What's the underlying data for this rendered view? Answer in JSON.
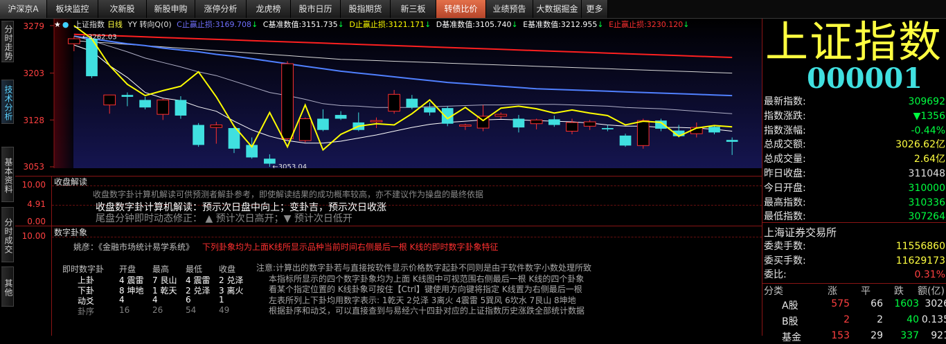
{
  "menu": {
    "items": [
      {
        "label": "沪深京A"
      },
      {
        "label": "板块监控"
      },
      {
        "label": "次新股"
      },
      {
        "label": "新股申购"
      },
      {
        "label": "涨停分析"
      },
      {
        "label": "龙虎榜"
      },
      {
        "label": "股市日历"
      },
      {
        "label": "股指期货"
      },
      {
        "label": "新三板"
      },
      {
        "label": "转债比价"
      },
      {
        "label": "业绩预告"
      },
      {
        "label": "大数据掘金"
      },
      {
        "label": "更多"
      }
    ],
    "highlight_color": "#d2593a"
  },
  "side_tabs": [
    {
      "label": "分时走势"
    },
    {
      "label": "技术分析"
    },
    {
      "label": "基本资料"
    },
    {
      "label": "分时成交"
    },
    {
      "label": "其他"
    }
  ],
  "chart": {
    "header": {
      "title": "上证指数",
      "period": "日线",
      "indicator": "YY 转向Q(0)",
      "c_label": "C止赢止损:",
      "c_value": "3169.708",
      "c_arrow": "↓",
      "cb_label": "C基准数值:",
      "cb_value": "3151.735",
      "cb_arrow": "↓",
      "d_label": "D止赢止损:",
      "d_value": "3121.171",
      "d_arrow": "↓",
      "db_label": "D基准数值:",
      "db_value": "3105.740",
      "db_arrow": "↓",
      "eb_label": "E基准数值:",
      "eb_value": "3212.955",
      "eb_arrow": "↓",
      "e_label": "E止赢止损:",
      "e_value": "3230.120",
      "e_arrow": "↓"
    },
    "y_ticks": [
      "3279",
      "3203",
      "3128",
      "3053"
    ],
    "high_label": "3262.03",
    "low_label": "3053.04",
    "colors": {
      "up": "#ff3030",
      "down": "#40e0e0",
      "yellow": "#ffff00",
      "white": "#ffffff",
      "red_ma": "#ff2020",
      "blue_ma": "#5080ff",
      "bg": "#0a0a40"
    }
  },
  "chart_data": {
    "type": "candlestick",
    "ylim": [
      3053,
      3279
    ],
    "candles": [
      {
        "o": 3250,
        "h": 3262,
        "l": 3238,
        "c": 3258
      },
      {
        "o": 3258,
        "h": 3260,
        "l": 3195,
        "c": 3198
      },
      {
        "o": 3152,
        "h": 3168,
        "l": 3138,
        "c": 3168
      },
      {
        "o": 3168,
        "h": 3172,
        "l": 3150,
        "c": 3165
      },
      {
        "o": 3160,
        "h": 3165,
        "l": 3145,
        "c": 3148
      },
      {
        "o": 3137,
        "h": 3162,
        "l": 3128,
        "c": 3160
      },
      {
        "o": 3160,
        "h": 3166,
        "l": 3130,
        "c": 3135
      },
      {
        "o": 3120,
        "h": 3123,
        "l": 3085,
        "c": 3088
      },
      {
        "o": 3116,
        "h": 3125,
        "l": 3090,
        "c": 3120
      },
      {
        "o": 3115,
        "h": 3120,
        "l": 3075,
        "c": 3082
      },
      {
        "o": 3088,
        "h": 3100,
        "l": 3066,
        "c": 3068
      },
      {
        "o": 3066,
        "h": 3073,
        "l": 3053,
        "c": 3058
      },
      {
        "o": 3098,
        "h": 3222,
        "l": 3095,
        "c": 3218
      },
      {
        "o": 3095,
        "h": 3132,
        "l": 3092,
        "c": 3130
      },
      {
        "o": 3130,
        "h": 3145,
        "l": 3110,
        "c": 3112
      },
      {
        "o": 3136,
        "h": 3142,
        "l": 3128,
        "c": 3130
      },
      {
        "o": 3124,
        "h": 3140,
        "l": 3110,
        "c": 3112
      },
      {
        "o": 3125,
        "h": 3132,
        "l": 3115,
        "c": 3127
      },
      {
        "o": 3142,
        "h": 3176,
        "l": 3138,
        "c": 3169
      },
      {
        "o": 3162,
        "h": 3168,
        "l": 3145,
        "c": 3148
      },
      {
        "o": 3148,
        "h": 3156,
        "l": 3135,
        "c": 3140
      },
      {
        "o": 3147,
        "h": 3150,
        "l": 3118,
        "c": 3122
      },
      {
        "o": 3118,
        "h": 3122,
        "l": 3112,
        "c": 3120
      },
      {
        "o": 3115,
        "h": 3152,
        "l": 3110,
        "c": 3134
      },
      {
        "o": 3134,
        "h": 3140,
        "l": 3130,
        "c": 3137
      },
      {
        "o": 3130,
        "h": 3136,
        "l": 3108,
        "c": 3116
      },
      {
        "o": 3122,
        "h": 3130,
        "l": 3113,
        "c": 3128
      },
      {
        "o": 3129,
        "h": 3135,
        "l": 3117,
        "c": 3120
      },
      {
        "o": 3110,
        "h": 3130,
        "l": 3105,
        "c": 3124
      },
      {
        "o": 3118,
        "h": 3128,
        "l": 3112,
        "c": 3125
      },
      {
        "o": 3115,
        "h": 3120,
        "l": 3110,
        "c": 3113
      },
      {
        "o": 3103,
        "h": 3106,
        "l": 3085,
        "c": 3087
      },
      {
        "o": 3087,
        "h": 3130,
        "l": 3082,
        "c": 3127
      },
      {
        "o": 3127,
        "h": 3130,
        "l": 3110,
        "c": 3114
      },
      {
        "o": 3111,
        "h": 3120,
        "l": 3100,
        "c": 3102
      },
      {
        "o": 3106,
        "h": 3124,
        "l": 3100,
        "c": 3116
      },
      {
        "o": 3117,
        "h": 3120,
        "l": 3105,
        "c": 3108
      },
      {
        "o": 3096,
        "h": 3100,
        "l": 3072,
        "c": 3093
      }
    ],
    "lines": {
      "yellow": [
        3279,
        3258,
        3215,
        3185,
        3167,
        3175,
        3182,
        3205,
        3165,
        3118,
        3085,
        3140,
        3085,
        3152,
        3080,
        3105,
        3118,
        3122,
        3120,
        3138,
        3160,
        3130,
        3148,
        3127,
        3147,
        3150,
        3146,
        3139,
        3144,
        3139,
        3135,
        3120,
        3126,
        3124,
        3102,
        3115,
        3119,
        3117
      ],
      "white": [
        3248,
        3238,
        3215,
        3196,
        3172,
        3163,
        3159,
        3149,
        3142,
        3126,
        3112,
        3102,
        3095,
        3091,
        3091,
        3094,
        3099,
        3104,
        3110,
        3116,
        3121,
        3124,
        3126,
        3128,
        3129,
        3128,
        3127,
        3126,
        3125,
        3123,
        3120,
        3118,
        3118,
        3116,
        3116,
        3115,
        3113,
        3110
      ],
      "grey": [
        3262,
        3255,
        3246,
        3237,
        3227,
        3220,
        3213,
        3205,
        3199,
        3190,
        3181,
        3172,
        3167,
        3161,
        3154,
        3151,
        3150,
        3148,
        3148,
        3148,
        3149,
        3150,
        3151,
        3152,
        3152,
        3153,
        3153,
        3153,
        3152,
        3151,
        3150,
        3148,
        3147,
        3146,
        3144,
        3142,
        3140,
        3138
      ],
      "blue": [
        3262,
        3258,
        3254,
        3250,
        3247,
        3243,
        3240,
        3237,
        3233,
        3230,
        3226,
        3222,
        3218,
        3214,
        3210,
        3206,
        3203,
        3200,
        3197,
        3194,
        3191,
        3188,
        3186,
        3184,
        3182,
        3180,
        3178,
        3177,
        3176,
        3175,
        3174,
        3173,
        3172,
        3171,
        3170,
        3169,
        3168,
        3167
      ],
      "offwhite": [
        3255,
        3253,
        3251,
        3249,
        3247,
        3245,
        3243,
        3241,
        3239,
        3237,
        3235,
        3233,
        3231,
        3229,
        3227,
        3225,
        3224,
        3223,
        3222,
        3221,
        3220,
        3219,
        3218,
        3217,
        3216,
        3215,
        3214,
        3213,
        3212,
        3211,
        3210,
        3209,
        3208,
        3207,
        3206,
        3205,
        3204,
        3203
      ],
      "red": [
        3265,
        3264,
        3263,
        3262,
        3261,
        3260,
        3259,
        3258,
        3257,
        3256,
        3255,
        3254,
        3253,
        3252,
        3251,
        3250,
        3249,
        3248,
        3247,
        3246,
        3245,
        3244,
        3243,
        3242,
        3241,
        3240,
        3239,
        3238,
        3237,
        3236,
        3235,
        3234,
        3233,
        3232,
        3231,
        3230,
        3229,
        3228
      ]
    }
  },
  "panel1": {
    "title": "收盘解读",
    "scale": [
      "10.00",
      "4.91",
      "0.00"
    ],
    "line1": "收盘数字卦计算机解读可供预测者解卦参考，即使解读结果的成功概率较高，亦不建议作为操盘的最终依据",
    "line2": "收盘数字卦计算机解读：预示次日盘中向上；变卦吉，预示次日收涨",
    "line3": "尾盘分钟即时动态修正：  ▲ 预计次日高开；▼ 预计次日低开"
  },
  "panel2": {
    "title": "数字卦象",
    "scale": [
      "10.00"
    ],
    "subtitle_black": "姚彦：《金融市场统计易学系统》",
    "subtitle_red": "下列卦象均为上面K线所显示品种当前时间右侧最后一根 K线的即时数字卦象特征",
    "table_headers": [
      "即时数字卦",
      "开盘",
      "最高",
      "最低",
      "收盘"
    ],
    "rows": [
      {
        "name": "上卦",
        "c1": "4 震雷",
        "c2": "7 艮山",
        "c3": "4 震雷",
        "c4": "2 兑泽"
      },
      {
        "name": "下卦",
        "c1": "8 坤地",
        "c2": "1 乾天",
        "c3": "2 兑泽",
        "c4": "3 离火"
      },
      {
        "name": "动爻",
        "c1": "4",
        "c2": "4",
        "c3": "6",
        "c4": "1"
      },
      {
        "name": "卦序",
        "c1": "16",
        "c2": "26",
        "c3": "54",
        "c4": "49"
      }
    ],
    "notes": [
      "注意:计算出的数字卦若与直接按软件显示价格数字起卦不同则是由于软件数字小数处理所致",
      "本指标所显示的四个数字卦象均为上面 K线图中可视范围右侧最后一根 K线的四个卦象",
      "看某个指定位置的 K线卦象可按住【Ctrl】键使用方向键将指定 K线置为右侧最后一根",
      "左表所列上下卦均用数字表示: 1乾天 2兑泽 3离火 4震雷 5巽风 6坎水 7艮山 8坤地",
      "根据卦序和动爻，可以直接查到与易经六十四卦对应的上证指数历史涨跌全部统计数据"
    ]
  },
  "quote": {
    "name": "上证指数",
    "code": "000001",
    "rows": [
      {
        "label": "最新指数:",
        "value": "309692",
        "color": "#00ff40"
      },
      {
        "label": "指数涨跌:",
        "value": "▼1356",
        "color": "#00ff40"
      },
      {
        "label": "指数涨幅:",
        "value": "-0.44%",
        "color": "#00ff40"
      },
      {
        "label": "总成交额:",
        "value": "3026.62亿",
        "color": "#ffff40"
      },
      {
        "label": "总成交量:",
        "value": "2.64亿",
        "color": "#ffff40"
      },
      {
        "label": "昨日收盘:",
        "value": "311048",
        "color": "#e0e0e0"
      },
      {
        "label": "今日开盘:",
        "value": "310000",
        "color": "#00ff40"
      },
      {
        "label": "最高指数:",
        "value": "310336",
        "color": "#00ff40"
      },
      {
        "label": "最低指数:",
        "value": "307264",
        "color": "#00ff40"
      }
    ],
    "exchange": "上海证券交易所",
    "rows2": [
      {
        "label": "委卖手数:",
        "value": "11556860",
        "color": "#ffff40"
      },
      {
        "label": "委买手数:",
        "value": "11629173",
        "color": "#ffff40"
      },
      {
        "label": "委比:",
        "value": "0.31%",
        "color": "#ff4040"
      }
    ],
    "table_header": [
      "分类",
      "涨",
      "平",
      "跌",
      "额(亿)"
    ],
    "table_rows": [
      {
        "cat": "A股",
        "up": "575",
        "flat": "66",
        "down": "1603",
        "amt": "3026"
      },
      {
        "cat": "B股",
        "up": "2",
        "flat": "2",
        "down": "40",
        "amt": "0.135"
      },
      {
        "cat": "基金",
        "up": "153",
        "flat": "29",
        "down": "337",
        "amt": "921"
      }
    ]
  }
}
